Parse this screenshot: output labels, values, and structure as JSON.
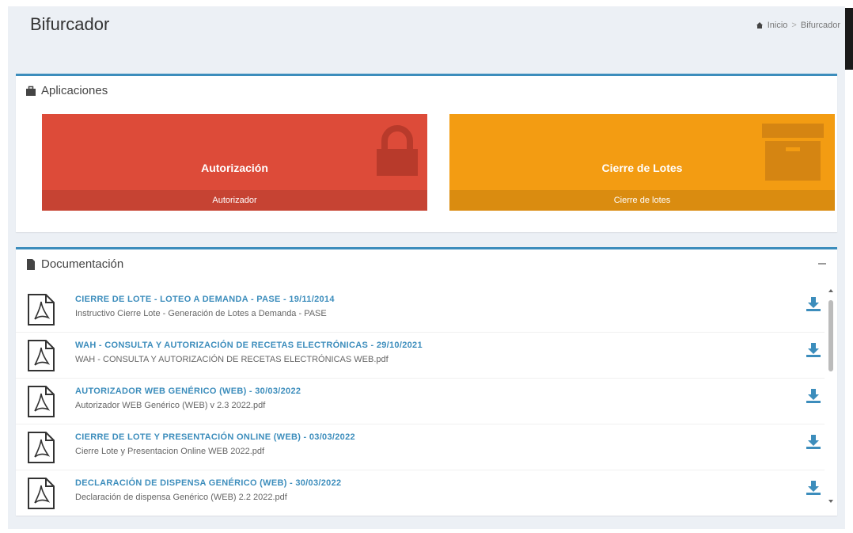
{
  "header": {
    "title": "Bifurcador",
    "breadcrumb": [
      "Inicio",
      "Bifurcador"
    ]
  },
  "apps": {
    "title": "Aplicaciones",
    "tiles": [
      {
        "label": "Autorización",
        "footer": "Autorizador",
        "color": "#dd4b39",
        "icon": "lock-icon"
      },
      {
        "label": "Cierre de Lotes",
        "footer": "Cierre de lotes",
        "color": "#f39c12",
        "icon": "archive-icon"
      }
    ]
  },
  "docs": {
    "title": "Documentación",
    "items": [
      {
        "title": "CIERRE DE LOTE - LOTEO A DEMANDA - PASE - 19/11/2014",
        "desc": "Instructivo Cierre Lote - Generación de Lotes a Demanda - PASE"
      },
      {
        "title": "WAH - CONSULTA Y AUTORIZACIÓN DE RECETAS ELECTRÓNICAS - 29/10/2021",
        "desc": "WAH - CONSULTA Y AUTORIZACIÓN DE RECETAS ELECTRÓNICAS WEB.pdf"
      },
      {
        "title": "AUTORIZADOR WEB GENÉRICO (WEB) - 30/03/2022",
        "desc": "Autorizador WEB Genérico (WEB) v 2.3 2022.pdf"
      },
      {
        "title": "CIERRE DE LOTE Y PRESENTACIÓN ONLINE (WEB) - 03/03/2022",
        "desc": "Cierre Lote y Presentacion Online WEB 2022.pdf"
      },
      {
        "title": "DECLARACIÓN DE DISPENSA GENÉRICO (WEB) - 30/03/2022",
        "desc": "Declaración de dispensa Genérico (WEB) 2.2 2022.pdf"
      }
    ]
  }
}
